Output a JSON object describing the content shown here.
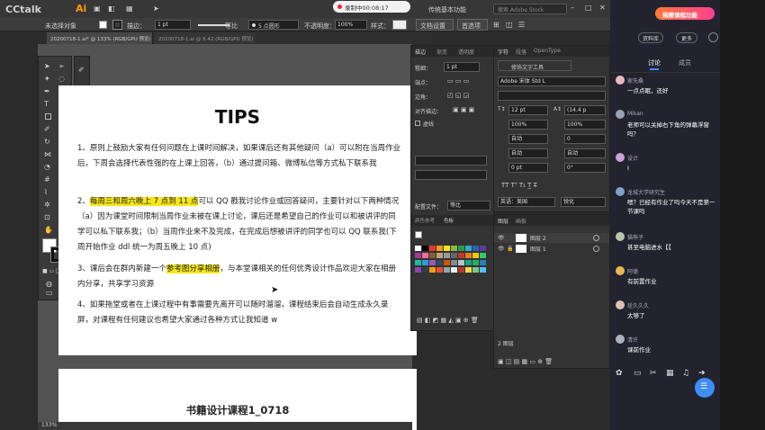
{
  "player": {
    "logo": "CCtalk",
    "rec_label": "录制中00:08:17"
  },
  "ai": {
    "logo": "Ai",
    "search_placeholder": "搜索 Adobe Stock",
    "workspace": "传统基本功能",
    "control": {
      "selection": "未选择对象",
      "stroke_label": "描边：",
      "stroke_val": "1 pt",
      "uniform": "等比",
      "brush": "5 点圆形",
      "opacity_label": "不透明度：",
      "opacity_val": "100%",
      "style_label": "样式：",
      "doc_setup": "文档设置",
      "prefs": "首选项"
    },
    "tabs": [
      "20200718-1.ai* @ 133% (RGB/GPU 预览)",
      "20200718-1.ai @ 8.42 (RGB/GPU 预览)"
    ],
    "status": "133%"
  },
  "doc": {
    "title": "TIPS",
    "p1": "1、原则上鼓励大家有任何问题在上课时间解决，如果课后还有其他疑问（a）可以附在当周作业后，下周会选择代表性强的在上课上回答，（b）通过提问箱、微博私信等方式私下联系我",
    "p2_pre": "2、",
    "p2_hl": "每周三和周六晚上 7 点到 11 点",
    "p2_post": "可以 QQ 戳我讨论作业或回答疑问，主要针对以下两种情况（a）因为课堂时间限制当周作业未被在课上讨论，课后还是希望自己的作业可以和被讲评的同学可以私下联系我；（b）当周作业来不及完成，在完成后想被讲评的同学也可以 QQ 联系我(下周开始作业 ddl 统一为周五晚上 10 点)",
    "p3_pre": "3、课后会在群内新建一个",
    "p3_hl": "参考图分享相册",
    "p3_post": "，与本堂课相关的任何优秀设计作品欢迎大家在相册内分享，共享学习资源",
    "p4": "4、如果拖堂或者在上课过程中有事需要先离开可以随时溜溜，课程结束后会自动生成永久录屏，对课程有任何建议也希望大家通过各种方式让我知道 w",
    "page2_title": "书籍设计课程1_0718"
  },
  "stroke_panel": {
    "tabs": [
      "描边",
      "渐变",
      "透明度"
    ],
    "weight_label": "粗细：",
    "weight_val": "1 pt",
    "cap_label": "端点：",
    "corner_label": "边角：",
    "align_label": "对齐描边：",
    "dashed_label": "虚线",
    "profile_label": "配置文件：",
    "profile_val": "等比"
  },
  "char_panel": {
    "tabs": [
      "字符",
      "段落",
      "OpenType"
    ],
    "touch_tool": "修饰文字工具",
    "font": "Adobe 宋体 Std L",
    "size": "12 pt",
    "leading": "(14.4 p",
    "vscale": "100%",
    "hscale": "100%",
    "kern": "自动",
    "track": "0",
    "auto1": "自动",
    "auto2": "自动",
    "baseline": "0 pt",
    "rotate": "0°",
    "lang": "英语：美国",
    "aa": "锐化"
  },
  "swatch_panel": {
    "tabs": [
      "颜色参考",
      "色板"
    ]
  },
  "layers_panel": {
    "tabs": [
      "图层",
      "画板"
    ],
    "layers": [
      "图层 2",
      "图层 1"
    ],
    "footer": "2 图层"
  },
  "side": {
    "brand": "捐赠课程功能",
    "btn_files": "资料库",
    "btn_more": "更多",
    "tab_discuss": "讨论",
    "tab_members": "成员",
    "messages": [
      {
        "name": "家先桑",
        "text": "一点点眠，还好"
      },
      {
        "name": "Mikan",
        "text": "老师可以关掉右下角的弹幕浮窗吗？"
      },
      {
        "name": "设计",
        "text": "I"
      },
      {
        "name": "龙城大学研究生",
        "text": "嗯？已经有作业了吗今天不是第一节课吗"
      },
      {
        "name": "猫熊子",
        "text": "甚至电脑进水【【"
      },
      {
        "name": "阿德",
        "text": "有前置作业"
      },
      {
        "name": "尬久久久",
        "text": "太够了"
      },
      {
        "name": "清许",
        "text": "课前作业"
      }
    ]
  },
  "colors": {
    "accent": "#3d8ef5",
    "highlight": "#f7e619",
    "ai_orange": "#ff9a00",
    "side_bg": "#232330"
  }
}
